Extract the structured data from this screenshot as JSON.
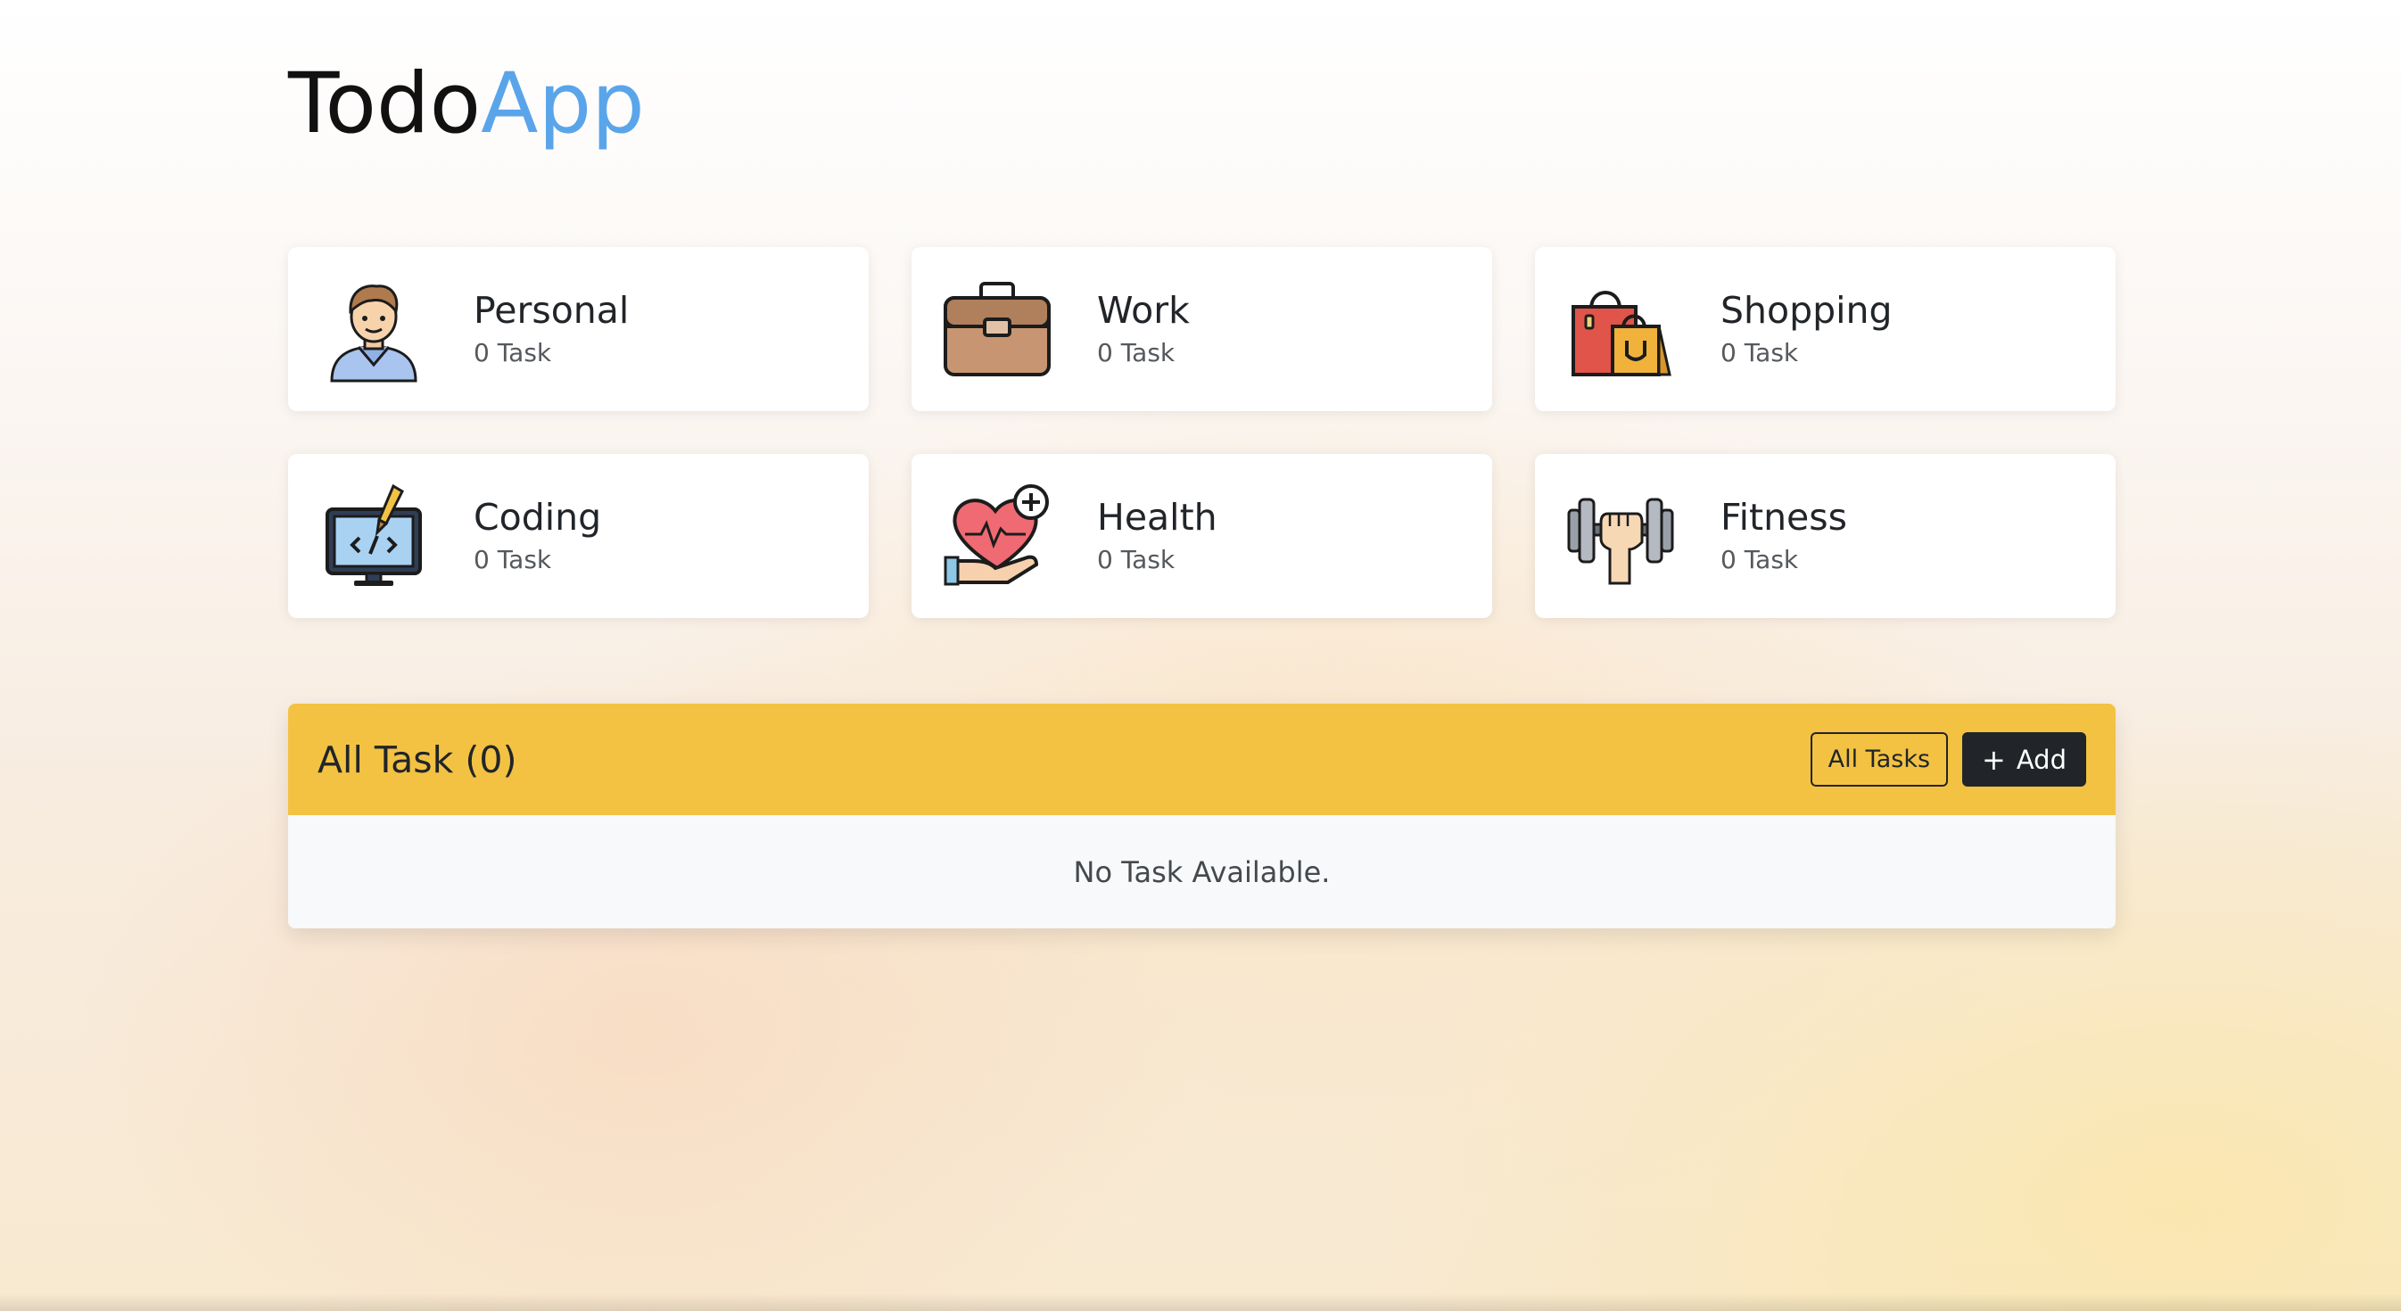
{
  "app": {
    "logo_part1": "Todo",
    "logo_part2": "App"
  },
  "colors": {
    "accent": "#f3c243",
    "logo_blue": "#5aa5ea",
    "dark": "#212529"
  },
  "categories": [
    {
      "title": "Personal",
      "count": "0 Task",
      "icon": "person-icon"
    },
    {
      "title": "Work",
      "count": "0 Task",
      "icon": "briefcase-icon"
    },
    {
      "title": "Shopping",
      "count": "0 Task",
      "icon": "shopping-bags-icon"
    },
    {
      "title": "Coding",
      "count": "0 Task",
      "icon": "coding-monitor-icon"
    },
    {
      "title": "Health",
      "count": "0 Task",
      "icon": "health-heart-icon"
    },
    {
      "title": "Fitness",
      "count": "0 Task",
      "icon": "dumbbell-icon"
    }
  ],
  "tasks": {
    "heading": "All Task (0)",
    "filter_label": "All Tasks",
    "add_label": "Add",
    "empty_message": "No Task Available."
  }
}
